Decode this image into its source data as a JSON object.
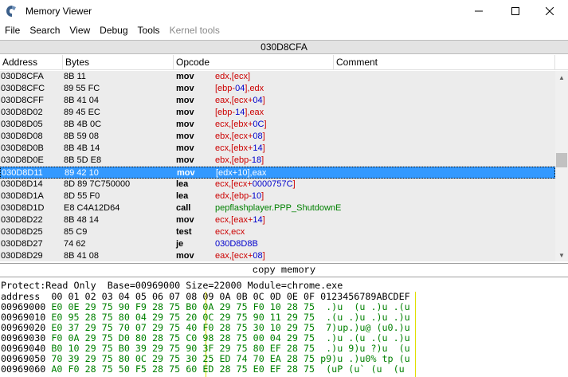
{
  "window": {
    "title": "Memory Viewer"
  },
  "menu": [
    "File",
    "Search",
    "View",
    "Debug",
    "Tools",
    "Kernel tools"
  ],
  "address_bar": "030D8CFA",
  "columns": {
    "address": "Address",
    "bytes": "Bytes",
    "opcode": "Opcode",
    "comment": "Comment"
  },
  "disasm": [
    {
      "addr": "030D8CFA",
      "bytes": "8B 11",
      "op": "mov",
      "args": [
        {
          "t": "edx",
          "c": "reg"
        },
        {
          "t": ",[",
          "c": "reg"
        },
        {
          "t": "ecx",
          "c": "reg"
        },
        {
          "t": "]",
          "c": "reg"
        }
      ]
    },
    {
      "addr": "030D8CFC",
      "bytes": "89 55 FC",
      "op": "mov",
      "args": [
        {
          "t": "[ebp-",
          "c": "reg"
        },
        {
          "t": "04",
          "c": "num"
        },
        {
          "t": "],edx",
          "c": "reg"
        }
      ]
    },
    {
      "addr": "030D8CFF",
      "bytes": "8B 41 04",
      "op": "mov",
      "args": [
        {
          "t": "eax,[ecx+",
          "c": "reg"
        },
        {
          "t": "04",
          "c": "num"
        },
        {
          "t": "]",
          "c": "reg"
        }
      ]
    },
    {
      "addr": "030D8D02",
      "bytes": "89 45 EC",
      "op": "mov",
      "args": [
        {
          "t": "[ebp-",
          "c": "reg"
        },
        {
          "t": "14",
          "c": "num"
        },
        {
          "t": "],eax",
          "c": "reg"
        }
      ]
    },
    {
      "addr": "030D8D05",
      "bytes": "8B 4B 0C",
      "op": "mov",
      "args": [
        {
          "t": "ecx,[ebx+",
          "c": "reg"
        },
        {
          "t": "0C",
          "c": "num"
        },
        {
          "t": "]",
          "c": "reg"
        }
      ]
    },
    {
      "addr": "030D8D08",
      "bytes": "8B 59 08",
      "op": "mov",
      "args": [
        {
          "t": "ebx,[ecx+",
          "c": "reg"
        },
        {
          "t": "08",
          "c": "num"
        },
        {
          "t": "]",
          "c": "reg"
        }
      ]
    },
    {
      "addr": "030D8D0B",
      "bytes": "8B 4B 14",
      "op": "mov",
      "args": [
        {
          "t": "ecx,[ebx+",
          "c": "reg"
        },
        {
          "t": "14",
          "c": "num"
        },
        {
          "t": "]",
          "c": "reg"
        }
      ]
    },
    {
      "addr": "030D8D0E",
      "bytes": "8B 5D E8",
      "op": "mov",
      "args": [
        {
          "t": "ebx,[ebp-",
          "c": "reg"
        },
        {
          "t": "18",
          "c": "num"
        },
        {
          "t": "]",
          "c": "reg"
        }
      ]
    },
    {
      "addr": "030D8D11",
      "bytes": "89 42 10",
      "op": "mov",
      "args": [
        {
          "t": "[edx+",
          "c": "reg"
        },
        {
          "t": "10",
          "c": "num"
        },
        {
          "t": "],eax",
          "c": "reg"
        }
      ],
      "selected": true
    },
    {
      "addr": "030D8D14",
      "bytes": "8D 89 7C750000",
      "op": "lea",
      "args": [
        {
          "t": "ecx,[ecx+",
          "c": "reg"
        },
        {
          "t": "0000757C",
          "c": "num"
        },
        {
          "t": "]",
          "c": "reg"
        }
      ]
    },
    {
      "addr": "030D8D1A",
      "bytes": "8D 55 F0",
      "op": "lea",
      "args": [
        {
          "t": "edx,[ebp-",
          "c": "reg"
        },
        {
          "t": "10",
          "c": "num"
        },
        {
          "t": "]",
          "c": "reg"
        }
      ]
    },
    {
      "addr": "030D8D1D",
      "bytes": "E8 C4A12D64",
      "op": "call",
      "args": [
        {
          "t": "pepflashplayer.PPP_ShutdownE",
          "c": "sym"
        }
      ]
    },
    {
      "addr": "030D8D22",
      "bytes": "8B 48 14",
      "op": "mov",
      "args": [
        {
          "t": "ecx,[eax+",
          "c": "reg"
        },
        {
          "t": "14",
          "c": "num"
        },
        {
          "t": "]",
          "c": "reg"
        }
      ]
    },
    {
      "addr": "030D8D25",
      "bytes": "85 C9",
      "op": "test",
      "args": [
        {
          "t": "ecx,ecx",
          "c": "reg"
        }
      ]
    },
    {
      "addr": "030D8D27",
      "bytes": "74 62",
      "op": "je",
      "args": [
        {
          "t": "030D8D8B",
          "c": "num"
        }
      ]
    },
    {
      "addr": "030D8D29",
      "bytes": "8B 41 08",
      "op": "mov",
      "args": [
        {
          "t": "eax,[ecx+",
          "c": "reg"
        },
        {
          "t": "08",
          "c": "num"
        },
        {
          "t": "]",
          "c": "reg"
        }
      ]
    }
  ],
  "copy_memory_label": "copy memory",
  "hex": {
    "info": "Protect:Read Only  Base=00969000 Size=22000 Module=chrome.exe",
    "header": "address  00 01 02 03 04 05 06 07 08 09 0A 0B 0C 0D 0E 0F 0123456789ABCDEF",
    "rows": [
      {
        "addr": "00969000",
        "bytes": "E0 0E 29 75 90 F9 28 75 B0 0A 29 75 F0 10 28 75",
        "ascii": " .)u  (u .)u .(u"
      },
      {
        "addr": "00969010",
        "bytes": "E0 95 28 75 80 04 29 75 20 0C 29 75 90 11 29 75",
        "ascii": " .(u .)u .)u .)u"
      },
      {
        "addr": "00969020",
        "bytes": "E0 37 29 75 70 07 29 75 40 F0 28 75 30 10 29 75",
        "ascii": " 7)up.)u@ (u0.)u"
      },
      {
        "addr": "00969030",
        "bytes": "F0 0A 29 75 D0 80 28 75 C0 98 28 75 00 04 29 75",
        "ascii": " .)u .(u .(u .)u"
      },
      {
        "addr": "00969040",
        "bytes": "B0 10 29 75 B0 39 29 75 90 3F 29 75 80 EF 28 75",
        "ascii": " .)u 9)u ?)u  (u"
      },
      {
        "addr": "00969050",
        "bytes": "70 39 29 75 80 0C 29 75 30 25 ED 74 70 EA 28 75",
        "ascii": "p9)u .)u0% tp (u"
      },
      {
        "addr": "00969060",
        "bytes": "A0 F0 28 75 50 F5 28 75 60 ED 28 75 E0 EF 28 75",
        "ascii": " (uP (u` (u  (u"
      }
    ]
  }
}
